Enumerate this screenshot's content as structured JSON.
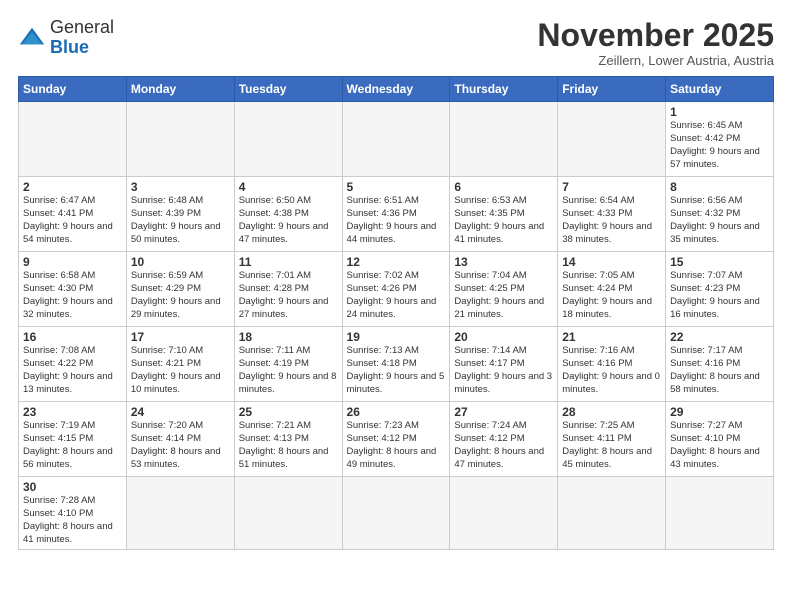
{
  "header": {
    "logo_general": "General",
    "logo_blue": "Blue",
    "month_title": "November 2025",
    "location": "Zeillern, Lower Austria, Austria"
  },
  "weekdays": [
    "Sunday",
    "Monday",
    "Tuesday",
    "Wednesday",
    "Thursday",
    "Friday",
    "Saturday"
  ],
  "weeks": [
    [
      {
        "day": "",
        "info": ""
      },
      {
        "day": "",
        "info": ""
      },
      {
        "day": "",
        "info": ""
      },
      {
        "day": "",
        "info": ""
      },
      {
        "day": "",
        "info": ""
      },
      {
        "day": "",
        "info": ""
      },
      {
        "day": "1",
        "info": "Sunrise: 6:45 AM\nSunset: 4:42 PM\nDaylight: 9 hours\nand 57 minutes."
      }
    ],
    [
      {
        "day": "2",
        "info": "Sunrise: 6:47 AM\nSunset: 4:41 PM\nDaylight: 9 hours\nand 54 minutes."
      },
      {
        "day": "3",
        "info": "Sunrise: 6:48 AM\nSunset: 4:39 PM\nDaylight: 9 hours\nand 50 minutes."
      },
      {
        "day": "4",
        "info": "Sunrise: 6:50 AM\nSunset: 4:38 PM\nDaylight: 9 hours\nand 47 minutes."
      },
      {
        "day": "5",
        "info": "Sunrise: 6:51 AM\nSunset: 4:36 PM\nDaylight: 9 hours\nand 44 minutes."
      },
      {
        "day": "6",
        "info": "Sunrise: 6:53 AM\nSunset: 4:35 PM\nDaylight: 9 hours\nand 41 minutes."
      },
      {
        "day": "7",
        "info": "Sunrise: 6:54 AM\nSunset: 4:33 PM\nDaylight: 9 hours\nand 38 minutes."
      },
      {
        "day": "8",
        "info": "Sunrise: 6:56 AM\nSunset: 4:32 PM\nDaylight: 9 hours\nand 35 minutes."
      }
    ],
    [
      {
        "day": "9",
        "info": "Sunrise: 6:58 AM\nSunset: 4:30 PM\nDaylight: 9 hours\nand 32 minutes."
      },
      {
        "day": "10",
        "info": "Sunrise: 6:59 AM\nSunset: 4:29 PM\nDaylight: 9 hours\nand 29 minutes."
      },
      {
        "day": "11",
        "info": "Sunrise: 7:01 AM\nSunset: 4:28 PM\nDaylight: 9 hours\nand 27 minutes."
      },
      {
        "day": "12",
        "info": "Sunrise: 7:02 AM\nSunset: 4:26 PM\nDaylight: 9 hours\nand 24 minutes."
      },
      {
        "day": "13",
        "info": "Sunrise: 7:04 AM\nSunset: 4:25 PM\nDaylight: 9 hours\nand 21 minutes."
      },
      {
        "day": "14",
        "info": "Sunrise: 7:05 AM\nSunset: 4:24 PM\nDaylight: 9 hours\nand 18 minutes."
      },
      {
        "day": "15",
        "info": "Sunrise: 7:07 AM\nSunset: 4:23 PM\nDaylight: 9 hours\nand 16 minutes."
      }
    ],
    [
      {
        "day": "16",
        "info": "Sunrise: 7:08 AM\nSunset: 4:22 PM\nDaylight: 9 hours\nand 13 minutes."
      },
      {
        "day": "17",
        "info": "Sunrise: 7:10 AM\nSunset: 4:21 PM\nDaylight: 9 hours\nand 10 minutes."
      },
      {
        "day": "18",
        "info": "Sunrise: 7:11 AM\nSunset: 4:19 PM\nDaylight: 9 hours\nand 8 minutes."
      },
      {
        "day": "19",
        "info": "Sunrise: 7:13 AM\nSunset: 4:18 PM\nDaylight: 9 hours\nand 5 minutes."
      },
      {
        "day": "20",
        "info": "Sunrise: 7:14 AM\nSunset: 4:17 PM\nDaylight: 9 hours\nand 3 minutes."
      },
      {
        "day": "21",
        "info": "Sunrise: 7:16 AM\nSunset: 4:16 PM\nDaylight: 9 hours\nand 0 minutes."
      },
      {
        "day": "22",
        "info": "Sunrise: 7:17 AM\nSunset: 4:16 PM\nDaylight: 8 hours\nand 58 minutes."
      }
    ],
    [
      {
        "day": "23",
        "info": "Sunrise: 7:19 AM\nSunset: 4:15 PM\nDaylight: 8 hours\nand 56 minutes."
      },
      {
        "day": "24",
        "info": "Sunrise: 7:20 AM\nSunset: 4:14 PM\nDaylight: 8 hours\nand 53 minutes."
      },
      {
        "day": "25",
        "info": "Sunrise: 7:21 AM\nSunset: 4:13 PM\nDaylight: 8 hours\nand 51 minutes."
      },
      {
        "day": "26",
        "info": "Sunrise: 7:23 AM\nSunset: 4:12 PM\nDaylight: 8 hours\nand 49 minutes."
      },
      {
        "day": "27",
        "info": "Sunrise: 7:24 AM\nSunset: 4:12 PM\nDaylight: 8 hours\nand 47 minutes."
      },
      {
        "day": "28",
        "info": "Sunrise: 7:25 AM\nSunset: 4:11 PM\nDaylight: 8 hours\nand 45 minutes."
      },
      {
        "day": "29",
        "info": "Sunrise: 7:27 AM\nSunset: 4:10 PM\nDaylight: 8 hours\nand 43 minutes."
      }
    ],
    [
      {
        "day": "30",
        "info": "Sunrise: 7:28 AM\nSunset: 4:10 PM\nDaylight: 8 hours\nand 41 minutes."
      },
      {
        "day": "",
        "info": ""
      },
      {
        "day": "",
        "info": ""
      },
      {
        "day": "",
        "info": ""
      },
      {
        "day": "",
        "info": ""
      },
      {
        "day": "",
        "info": ""
      },
      {
        "day": "",
        "info": ""
      }
    ]
  ]
}
